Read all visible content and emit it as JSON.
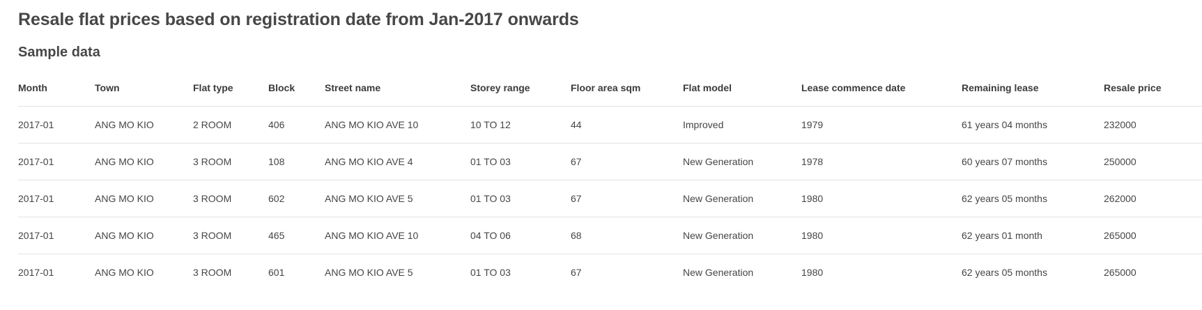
{
  "page": {
    "title": "Resale flat prices based on registration date from Jan-2017 onwards",
    "section_title": "Sample data"
  },
  "table": {
    "columns": [
      "Month",
      "Town",
      "Flat type",
      "Block",
      "Street name",
      "Storey range",
      "Floor area sqm",
      "Flat model",
      "Lease commence date",
      "Remaining lease",
      "Resale price"
    ],
    "rows": [
      [
        "2017-01",
        "ANG MO KIO",
        "2 ROOM",
        "406",
        "ANG MO KIO AVE 10",
        "10 TO 12",
        "44",
        "Improved",
        "1979",
        "61 years 04 months",
        "232000"
      ],
      [
        "2017-01",
        "ANG MO KIO",
        "3 ROOM",
        "108",
        "ANG MO KIO AVE 4",
        "01 TO 03",
        "67",
        "New Generation",
        "1978",
        "60 years 07 months",
        "250000"
      ],
      [
        "2017-01",
        "ANG MO KIO",
        "3 ROOM",
        "602",
        "ANG MO KIO AVE 5",
        "01 TO 03",
        "67",
        "New Generation",
        "1980",
        "62 years 05 months",
        "262000"
      ],
      [
        "2017-01",
        "ANG MO KIO",
        "3 ROOM",
        "465",
        "ANG MO KIO AVE 10",
        "04 TO 06",
        "68",
        "New Generation",
        "1980",
        "62 years 01 month",
        "265000"
      ],
      [
        "2017-01",
        "ANG MO KIO",
        "3 ROOM",
        "601",
        "ANG MO KIO AVE 5",
        "01 TO 03",
        "67",
        "New Generation",
        "1980",
        "62 years 05 months",
        "265000"
      ]
    ]
  },
  "colors": {
    "text": "#454545",
    "heading": "#474747",
    "divider": "#e3e3e3",
    "background": "#ffffff"
  }
}
